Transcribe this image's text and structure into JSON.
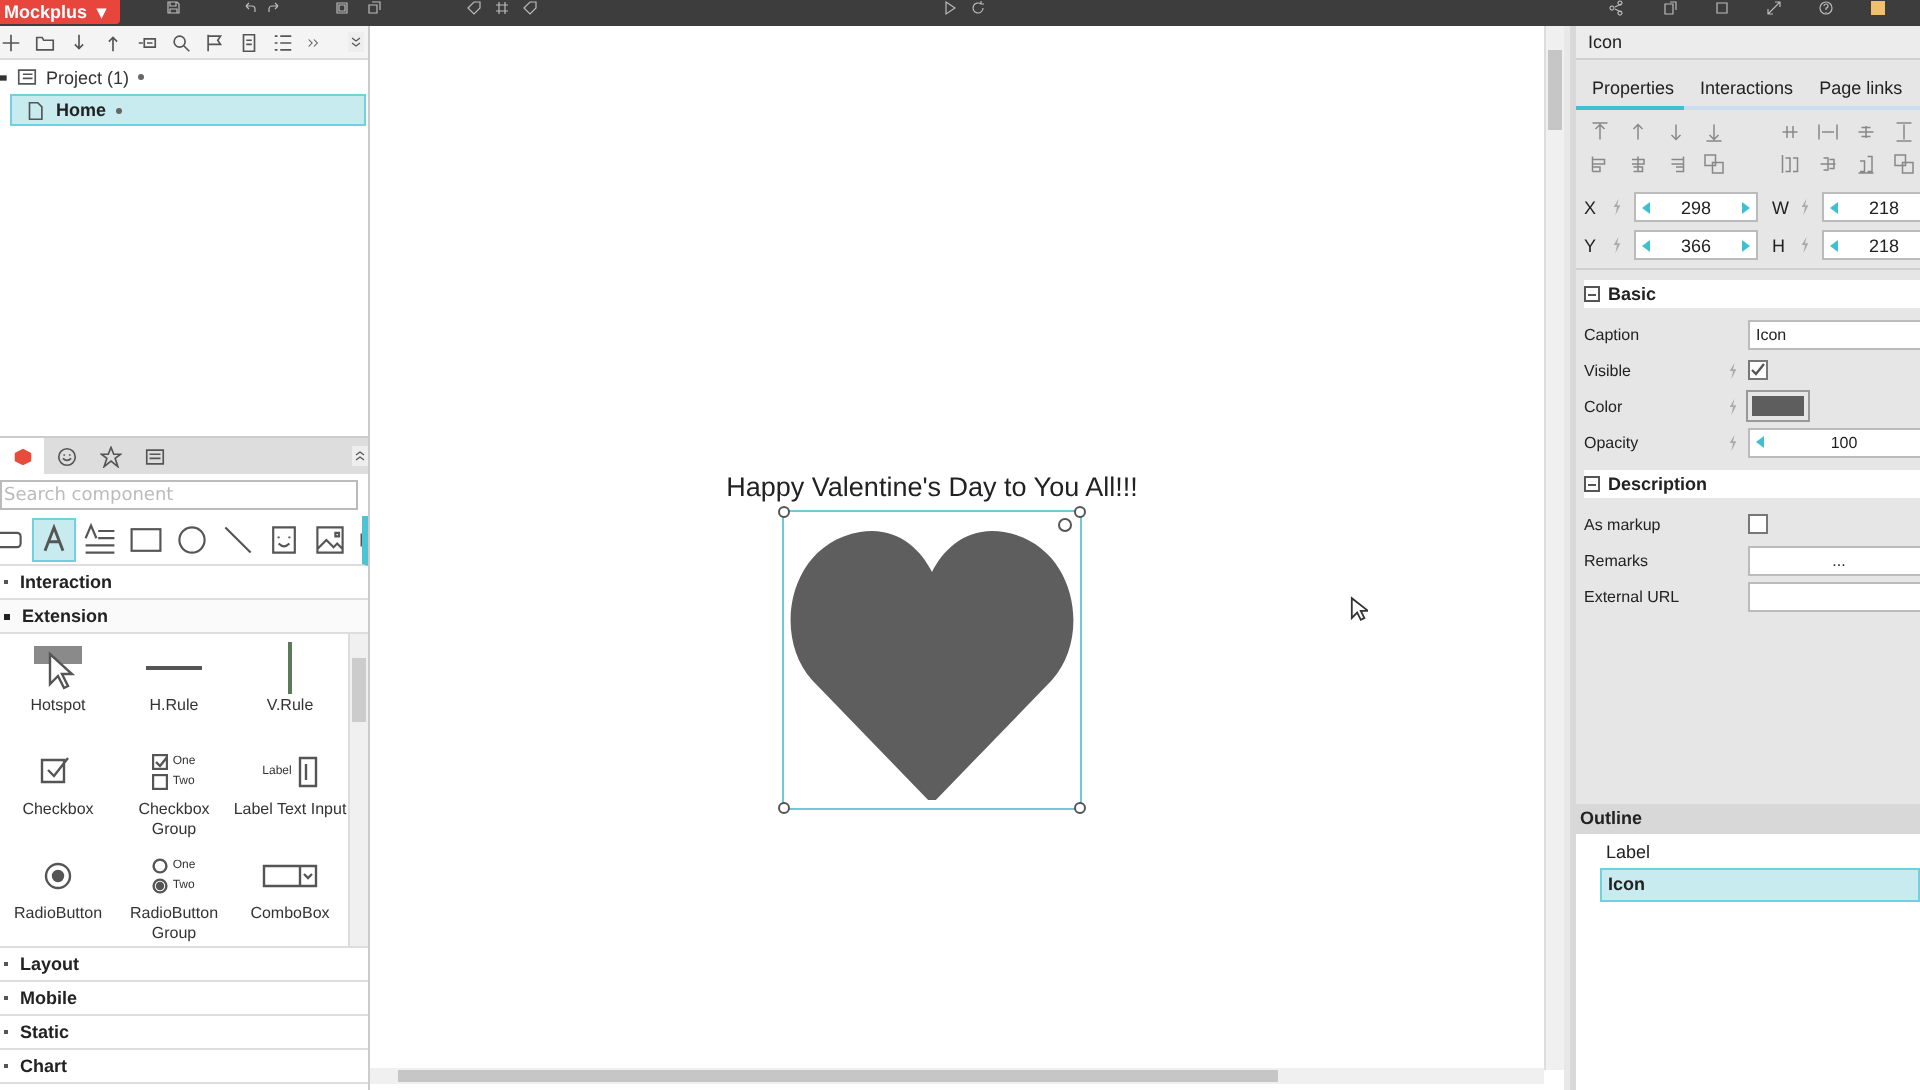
{
  "app": {
    "logo": "Mockplus",
    "logo_caret": "▾"
  },
  "project_tree": [
    {
      "label": "Project (1)",
      "expanded": true,
      "children": [
        {
          "label": "Home",
          "selected": true
        }
      ]
    }
  ],
  "component_panel": {
    "search": {
      "placeholder": "Search component"
    },
    "categories": [
      {
        "label": "Interaction",
        "expanded": false
      },
      {
        "label": "Extension",
        "expanded": true,
        "components": [
          {
            "label": "Hotspot",
            "kind": "hotspot"
          },
          {
            "label": "H.Rule",
            "kind": "hrule"
          },
          {
            "label": "V.Rule",
            "kind": "vrule"
          },
          {
            "label": "Checkbox",
            "kind": "checkbox"
          },
          {
            "label": "Checkbox Group",
            "kind": "checkbox-group",
            "options": [
              "One",
              "Two"
            ]
          },
          {
            "label": "Label Text Input",
            "kind": "label-input",
            "preview": "Label"
          },
          {
            "label": "RadioButton",
            "kind": "radio"
          },
          {
            "label": "RadioButton Group",
            "kind": "radio-group",
            "options": [
              "One",
              "Two"
            ]
          },
          {
            "label": "ComboBox",
            "kind": "combo"
          }
        ]
      },
      {
        "label": "Layout",
        "expanded": false
      },
      {
        "label": "Mobile",
        "expanded": false
      },
      {
        "label": "Static",
        "expanded": false
      },
      {
        "label": "Chart",
        "expanded": false
      }
    ]
  },
  "canvas": {
    "label": "Happy Valentine's Day to You All!!!",
    "icon_selected": true
  },
  "inspector": {
    "title": "Icon",
    "tabs": [
      {
        "label": "Properties",
        "selected": true
      },
      {
        "label": "Interactions",
        "selected": false
      },
      {
        "label": "Page links",
        "selected": false
      }
    ],
    "geometry": [
      {
        "label": "X",
        "value": "298"
      },
      {
        "label": "W",
        "value": "218"
      },
      {
        "label": "Y",
        "value": "366"
      },
      {
        "label": "H",
        "value": "218"
      }
    ],
    "basic": {
      "title": "Basic",
      "caption_label": "Caption",
      "caption": "Icon",
      "visible_label": "Visible",
      "visible": true,
      "color_label": "Color",
      "opacity_label": "Opacity",
      "opacity": "100"
    },
    "description": {
      "title": "Description",
      "markup_label": "As markup",
      "as_markup": false,
      "remarks_label": "Remarks",
      "remarks": "...",
      "url_label": "External URL"
    }
  },
  "outline": {
    "title": "Outline",
    "items": [
      {
        "label": "Label",
        "selected": false
      },
      {
        "label": "Icon",
        "selected": true
      }
    ]
  }
}
